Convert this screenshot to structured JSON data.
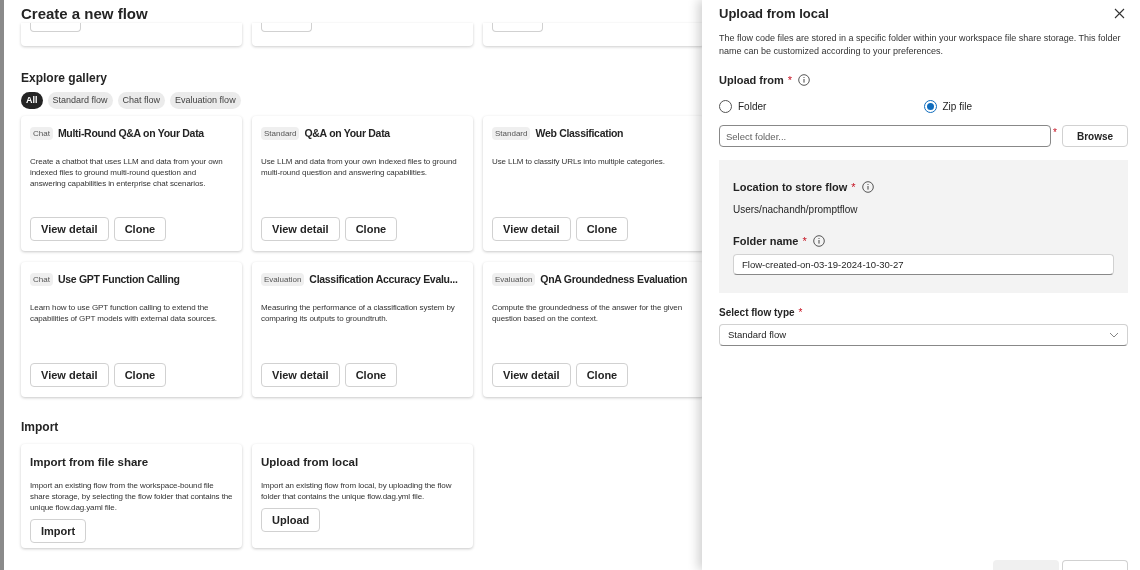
{
  "page": {
    "title": "Create a new flow"
  },
  "gallery": {
    "title": "Explore gallery",
    "filters": [
      {
        "label": "All",
        "selected": true
      },
      {
        "label": "Standard flow",
        "selected": false
      },
      {
        "label": "Chat flow",
        "selected": false
      },
      {
        "label": "Evaluation flow",
        "selected": false
      }
    ],
    "cards": [
      {
        "tag": "Chat",
        "title": "Multi-Round Q&A on Your Data",
        "description": "Create a chatbot that uses LLM and data from your own indexed files to ground multi-round question and answering capabilities in enterprise chat scenarios.",
        "buttons": [
          "View detail",
          "Clone"
        ]
      },
      {
        "tag": "Standard",
        "title": "Q&A on Your Data",
        "description": "Use LLM and data from your own indexed files to ground multi-round question and answering capabilities.",
        "buttons": [
          "View detail",
          "Clone"
        ]
      },
      {
        "tag": "Standard",
        "title": "Web Classification",
        "description": "Use LLM to classify URLs into multiple categories.",
        "buttons": [
          "View detail",
          "Clone"
        ]
      },
      {
        "tag": "Chat",
        "title": "Use GPT Function Calling",
        "description": "Learn how to use GPT function calling to extend the capabilities of GPT models with external data sources.",
        "buttons": [
          "View detail",
          "Clone"
        ]
      },
      {
        "tag": "Evaluation",
        "title": "Classification Accuracy Evalu...",
        "description": "Measuring the performance of a classification system by comparing its outputs to groundtruth.",
        "buttons": [
          "View detail",
          "Clone"
        ]
      },
      {
        "tag": "Evaluation",
        "title": "QnA Groundedness Evaluation",
        "description": "Compute the groundedness of the answer for the given question based on the context.",
        "buttons": [
          "View detail",
          "Clone"
        ]
      }
    ]
  },
  "import": {
    "title": "Import",
    "cards": [
      {
        "title": "Import from file share",
        "description": "Import an existing flow from the workspace-bound file share storage, by selecting the flow folder that contains the unique flow.dag.yaml file.",
        "button": "Import"
      },
      {
        "title": "Upload from local",
        "description": "Import an existing flow from local, by uploading the flow folder that contains the unique flow.dag.yml file.",
        "button": "Upload"
      }
    ]
  },
  "panel": {
    "title": "Upload from local",
    "description": "The flow code files are stored in a specific folder within your workspace file share storage. This folder name can be customized according to your preferences.",
    "upload_from": {
      "label": "Upload from",
      "required": "*",
      "options": [
        {
          "label": "Folder",
          "selected": false
        },
        {
          "label": "Zip file",
          "selected": true
        }
      ]
    },
    "file_field": {
      "placeholder": "Select folder...",
      "required": "*",
      "button": "Browse"
    },
    "location": {
      "label": "Location to store flow",
      "required": "*",
      "value": "Users/nachandh/promptflow"
    },
    "folder_name": {
      "label": "Folder name",
      "required": "*",
      "value": "Flow-created-on-03-19-2024-10-30-27"
    },
    "flow_type": {
      "label": "Select flow type",
      "required": "*",
      "value": "Standard flow"
    },
    "footer_buttons": [
      {
        "disabled": true
      },
      {
        "disabled": false
      }
    ]
  }
}
